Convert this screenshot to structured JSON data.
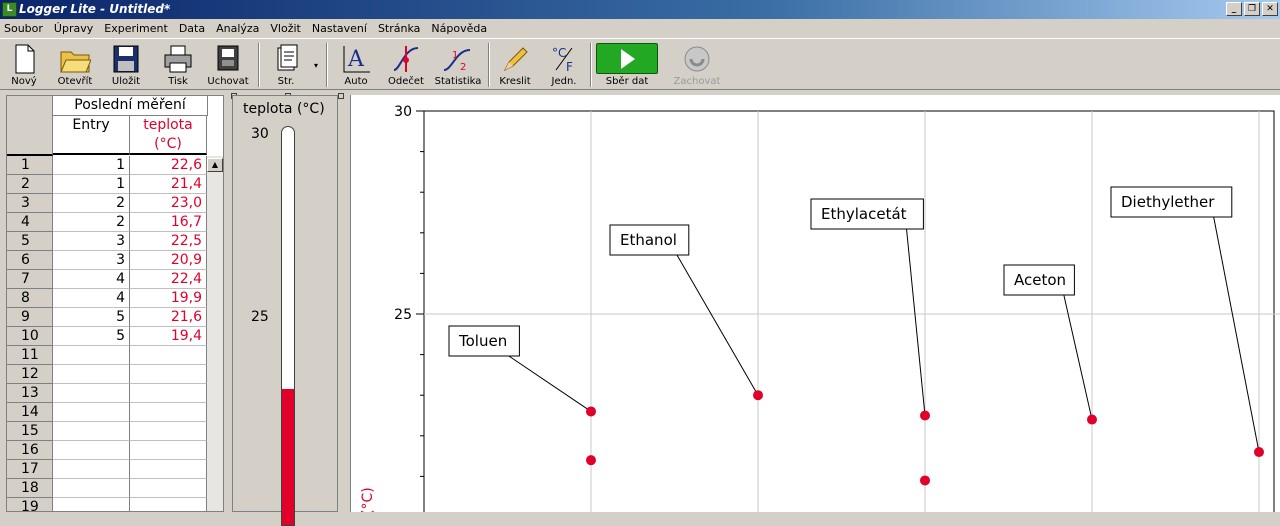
{
  "window": {
    "title": "Logger Lite - Untitled*",
    "app_icon_letter": "L"
  },
  "window_buttons": {
    "minimize": "_",
    "restore": "❐",
    "close": "✕"
  },
  "menu": [
    "Soubor",
    "Úpravy",
    "Experiment",
    "Data",
    "Analýza",
    "Vložit",
    "Nastavení",
    "Stránka",
    "Nápověda"
  ],
  "toolbar": {
    "new": "Nový",
    "open": "Otevřít",
    "save": "Uložit",
    "print": "Tisk",
    "store": "Uchovat",
    "page": "Str.",
    "auto": "Auto",
    "examine": "Odečet",
    "stats": "Statistika",
    "draw": "Kreslit",
    "units": "Jedn.",
    "collect": "Sběr dat",
    "keep": "Zachovat"
  },
  "table": {
    "group_header": "Poslední měření",
    "col1": "Entry",
    "col2_line1": "teplota",
    "col2_line2": "(°C)",
    "rows": [
      {
        "n": "1",
        "entry": "1",
        "temp": "22,6"
      },
      {
        "n": "2",
        "entry": "1",
        "temp": "21,4"
      },
      {
        "n": "3",
        "entry": "2",
        "temp": "23,0"
      },
      {
        "n": "4",
        "entry": "2",
        "temp": "16,7"
      },
      {
        "n": "5",
        "entry": "3",
        "temp": "22,5"
      },
      {
        "n": "6",
        "entry": "3",
        "temp": "20,9"
      },
      {
        "n": "7",
        "entry": "4",
        "temp": "22,4"
      },
      {
        "n": "8",
        "entry": "4",
        "temp": "19,9"
      },
      {
        "n": "9",
        "entry": "5",
        "temp": "21,6"
      },
      {
        "n": "10",
        "entry": "5",
        "temp": "19,4"
      },
      {
        "n": "11",
        "entry": "",
        "temp": ""
      },
      {
        "n": "12",
        "entry": "",
        "temp": ""
      },
      {
        "n": "13",
        "entry": "",
        "temp": ""
      },
      {
        "n": "14",
        "entry": "",
        "temp": ""
      },
      {
        "n": "15",
        "entry": "",
        "temp": ""
      },
      {
        "n": "16",
        "entry": "",
        "temp": ""
      },
      {
        "n": "17",
        "entry": "",
        "temp": ""
      },
      {
        "n": "18",
        "entry": "",
        "temp": ""
      },
      {
        "n": "19",
        "entry": "",
        "temp": ""
      }
    ]
  },
  "meter": {
    "title": "teplota (°C)",
    "tick_top": "30",
    "tick_mid": "25",
    "max": 30,
    "value": 23.0,
    "colors": {
      "fill": "#e0002a"
    }
  },
  "chart_data": {
    "type": "scatter",
    "ylabel": "(°C)",
    "y_ticks": [
      "30",
      "25"
    ],
    "ylim_visible": [
      19.5,
      30
    ],
    "x": [
      1,
      1,
      2,
      3,
      3,
      4,
      5
    ],
    "y": [
      22.6,
      21.4,
      23.0,
      22.5,
      20.9,
      22.4,
      21.6
    ],
    "annotations": [
      {
        "label": "Toluen",
        "x": 1,
        "y": 22.6
      },
      {
        "label": "Ethanol",
        "x": 2,
        "y": 23.0
      },
      {
        "label": "Ethylacetát",
        "x": 3,
        "y": 22.5
      },
      {
        "label": "Aceton",
        "x": 4,
        "y": 22.4
      },
      {
        "label": "Diethylether",
        "x": 5,
        "y": 21.6
      }
    ],
    "grid": true,
    "point_color": "#e0002a"
  }
}
